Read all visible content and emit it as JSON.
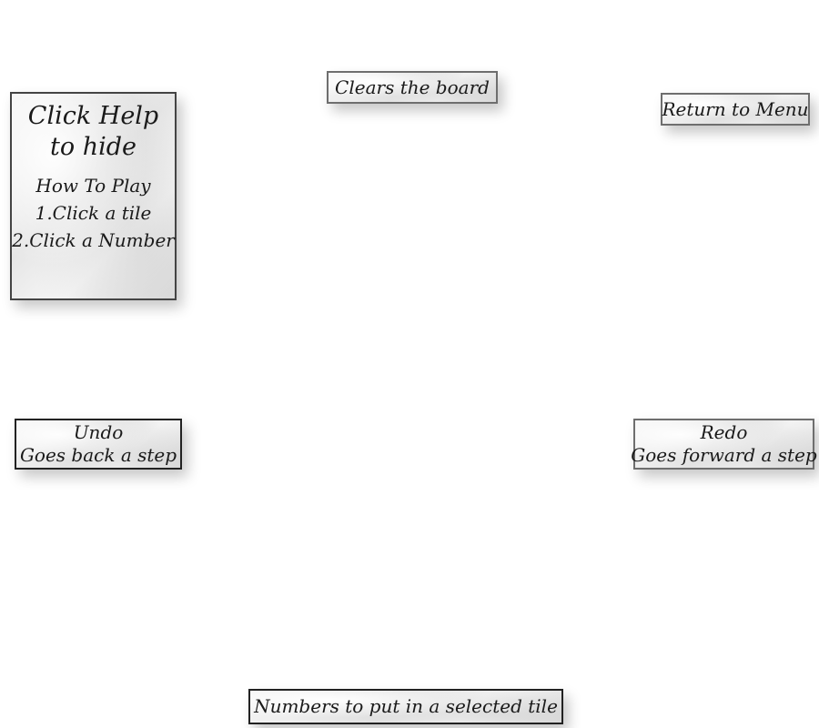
{
  "help_panel": {
    "title_lines": [
      "Click Help",
      "to hide"
    ],
    "steps": [
      "How To Play",
      "1.Click a tile",
      "2.Click a Number"
    ]
  },
  "clear_tip": {
    "label": "Clears the board"
  },
  "menu_tip": {
    "label": "Return to Menu"
  },
  "undo_tip": {
    "title": "Undo",
    "description": "Goes back a step"
  },
  "redo_tip": {
    "title": "Redo",
    "description": "Goes forward a step"
  },
  "numbers_tip": {
    "label": "Numbers to put in a selected tile"
  },
  "colors": {
    "background": "#ffffff",
    "tip_border": "#6e6e6e",
    "text": "#1a1a1a"
  }
}
